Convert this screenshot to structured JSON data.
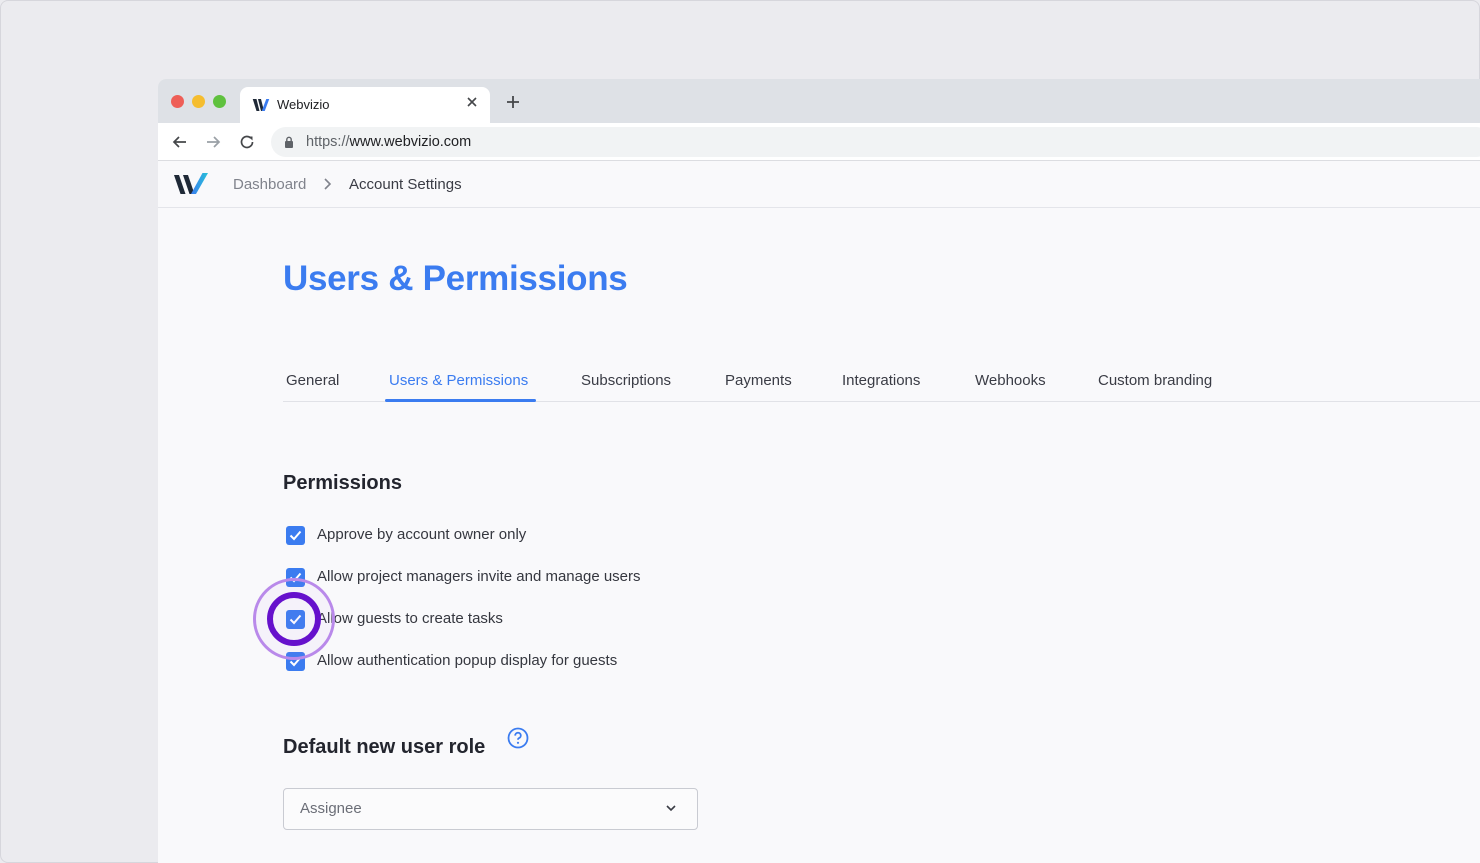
{
  "browser": {
    "tab_title": "Webvizio",
    "tab_close_icon": "close-icon",
    "new_tab_icon": "plus-icon",
    "url_scheme": "https://",
    "url_host": "www.webvizio.com"
  },
  "header": {
    "logo": "webvizio-logo",
    "breadcrumb": [
      "Dashboard",
      "Account Settings"
    ]
  },
  "main": {
    "title": "Users & Permissions",
    "tabs": [
      {
        "label": "General"
      },
      {
        "label": "Users & Permissions",
        "active": true
      },
      {
        "label": "Subscriptions"
      },
      {
        "label": "Payments"
      },
      {
        "label": "Integrations"
      },
      {
        "label": "Webhooks"
      },
      {
        "label": "Custom branding"
      }
    ],
    "permissions": {
      "title": "Permissions",
      "items": [
        {
          "label": "Approve by account owner only",
          "checked": true
        },
        {
          "label": "Allow project managers invite and manage users",
          "checked": true
        },
        {
          "label": "Allow guests to create tasks",
          "checked": true
        },
        {
          "label": "Allow authentication popup display for guests",
          "checked": true
        }
      ]
    },
    "default_role": {
      "title": "Default new user role",
      "help_icon": "question-circle-icon",
      "selected": "Assignee"
    }
  },
  "colors": {
    "accent": "#3b7cf0",
    "click_highlight": "#6611cc"
  }
}
